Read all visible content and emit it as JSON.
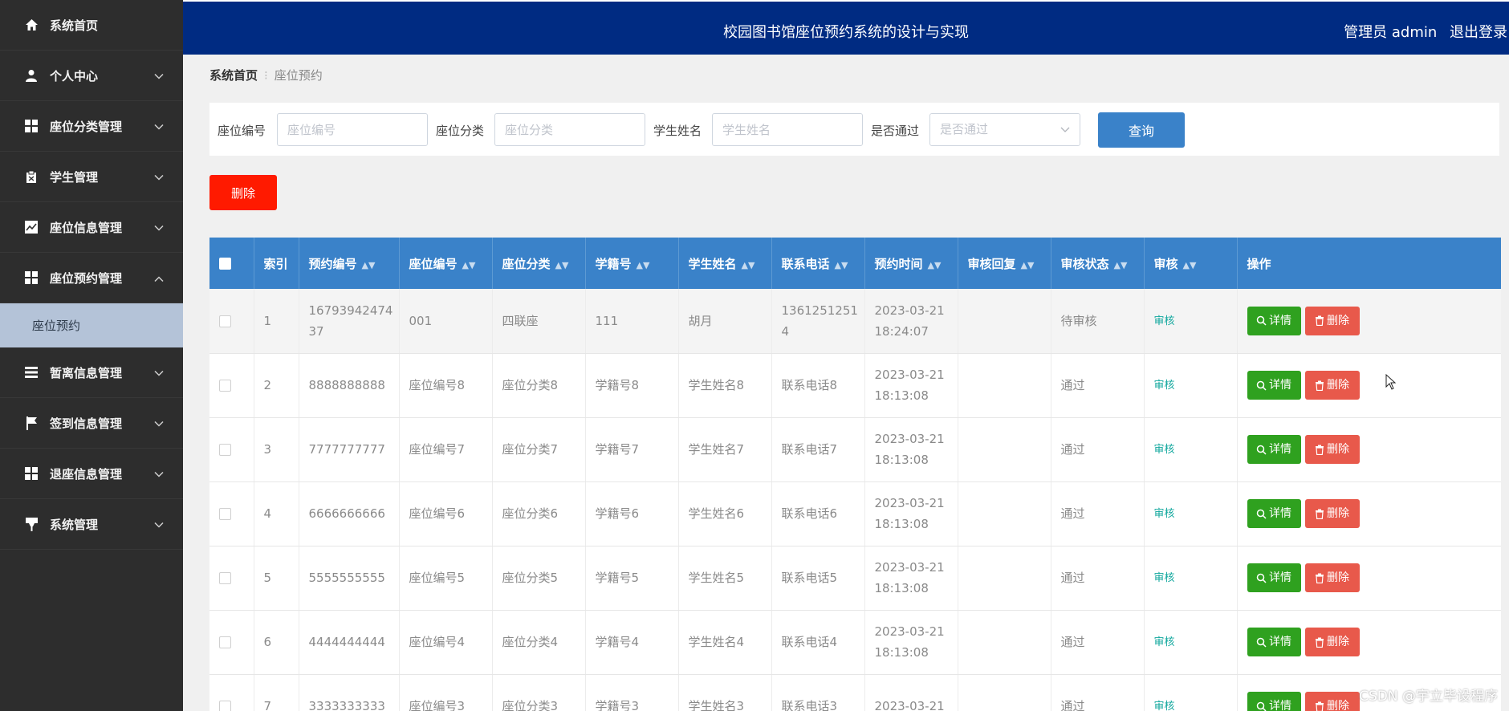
{
  "header": {
    "title": "校园图书馆座位预约系统的设计与实现",
    "user_label": "管理员 admin",
    "logout_label": "退出登录"
  },
  "sidebar": {
    "items": [
      {
        "label": "系统首页",
        "icon": "home-icon"
      },
      {
        "label": "个人中心",
        "icon": "user-icon"
      },
      {
        "label": "座位分类管理",
        "icon": "grid-icon"
      },
      {
        "label": "学生管理",
        "icon": "clipboard-icon"
      },
      {
        "label": "座位信息管理",
        "icon": "chart-icon"
      },
      {
        "label": "座位预约管理",
        "icon": "grid-icon"
      },
      {
        "label": "暂离信息管理",
        "icon": "list-icon"
      },
      {
        "label": "签到信息管理",
        "icon": "flag-icon"
      },
      {
        "label": "退座信息管理",
        "icon": "grid-icon"
      },
      {
        "label": "系统管理",
        "icon": "pin-icon"
      }
    ],
    "active_sub": "座位预约"
  },
  "breadcrumb": {
    "home": "系统首页",
    "current": "座位预约"
  },
  "search": {
    "seat_no_label": "座位编号",
    "seat_no_placeholder": "座位编号",
    "category_label": "座位分类",
    "category_placeholder": "座位分类",
    "student_label": "学生姓名",
    "student_placeholder": "学生姓名",
    "passed_label": "是否通过",
    "passed_placeholder": "是否通过",
    "query_label": "查询"
  },
  "delete_label": "删除",
  "table": {
    "headers": [
      "索引",
      "预约编号",
      "座位编号",
      "座位分类",
      "学籍号",
      "学生姓名",
      "联系电话",
      "预约时间",
      "审核回复",
      "审核状态",
      "审核",
      "操作"
    ],
    "rows": [
      {
        "index": "1",
        "booking_no": "1679394247437",
        "seat_no": "001",
        "category": "四联座",
        "student_id": "111",
        "name": "胡月",
        "phone": "13612512514",
        "date": "2023-03-21",
        "time": "18:24:07",
        "reply": "",
        "status": "待审核",
        "review": "审核"
      },
      {
        "index": "2",
        "booking_no": "8888888888",
        "seat_no": "座位编号8",
        "category": "座位分类8",
        "student_id": "学籍号8",
        "name": "学生姓名8",
        "phone": "联系电话8",
        "date": "2023-03-21",
        "time": "18:13:08",
        "reply": "",
        "status": "通过",
        "review": "审核"
      },
      {
        "index": "3",
        "booking_no": "7777777777",
        "seat_no": "座位编号7",
        "category": "座位分类7",
        "student_id": "学籍号7",
        "name": "学生姓名7",
        "phone": "联系电话7",
        "date": "2023-03-21",
        "time": "18:13:08",
        "reply": "",
        "status": "通过",
        "review": "审核"
      },
      {
        "index": "4",
        "booking_no": "6666666666",
        "seat_no": "座位编号6",
        "category": "座位分类6",
        "student_id": "学籍号6",
        "name": "学生姓名6",
        "phone": "联系电话6",
        "date": "2023-03-21",
        "time": "18:13:08",
        "reply": "",
        "status": "通过",
        "review": "审核"
      },
      {
        "index": "5",
        "booking_no": "5555555555",
        "seat_no": "座位编号5",
        "category": "座位分类5",
        "student_id": "学籍号5",
        "name": "学生姓名5",
        "phone": "联系电话5",
        "date": "2023-03-21",
        "time": "18:13:08",
        "reply": "",
        "status": "通过",
        "review": "审核"
      },
      {
        "index": "6",
        "booking_no": "4444444444",
        "seat_no": "座位编号4",
        "category": "座位分类4",
        "student_id": "学籍号4",
        "name": "学生姓名4",
        "phone": "联系电话4",
        "date": "2023-03-21",
        "time": "18:13:08",
        "reply": "",
        "status": "通过",
        "review": "审核"
      },
      {
        "index": "7",
        "booking_no": "3333333333",
        "seat_no": "座位编号3",
        "category": "座位分类3",
        "student_id": "学籍号3",
        "name": "学生姓名3",
        "phone": "联系电话3",
        "date": "2023-03-21",
        "time": "",
        "reply": "",
        "status": "通过",
        "review": "审核"
      }
    ],
    "detail_label": "详情",
    "delete_label": "删除"
  },
  "colors": {
    "header": "#002b82",
    "sidebar": "#2d2d2d",
    "table_head": "#3a82c9",
    "detail_btn": "#2fa11f",
    "delete_btn": "#e8594b",
    "delete_top": "#ff1a00"
  },
  "watermark": "CSDN @宇立毕设程序"
}
